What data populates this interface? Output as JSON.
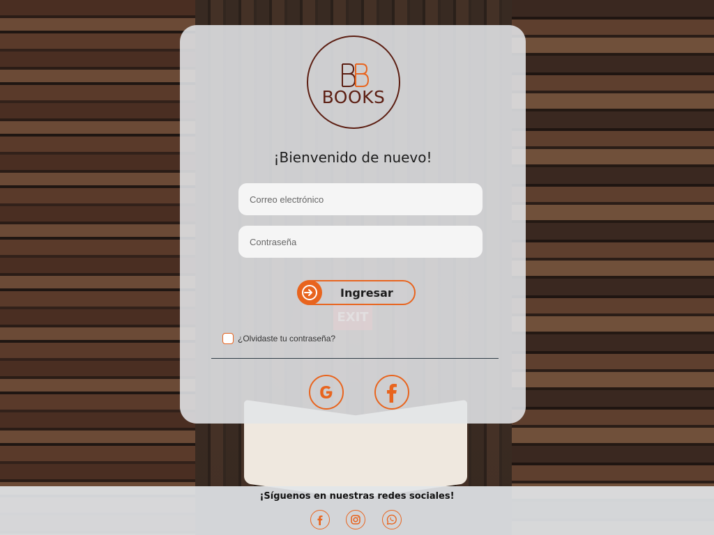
{
  "brand": {
    "logo_text": "BOOKS",
    "colors": {
      "accent": "#e8641e",
      "logo": "#5c1e12"
    }
  },
  "login": {
    "welcome": "¡Bienvenido de nuevo!",
    "email_placeholder": "Correo electrónico",
    "password_placeholder": "Contraseña",
    "submit_label": "Ingresar",
    "submit_icon": "login-arrow-icon",
    "forgot_label": "¿Olvidaste tu contraseña?"
  },
  "social_login": [
    {
      "icon": "google-icon"
    },
    {
      "icon": "facebook-icon"
    }
  ],
  "footer": {
    "title": "¡Síguenos en nuestras redes sociales!",
    "links": [
      {
        "icon": "facebook-icon"
      },
      {
        "icon": "instagram-icon"
      },
      {
        "icon": "whatsapp-icon"
      }
    ]
  }
}
